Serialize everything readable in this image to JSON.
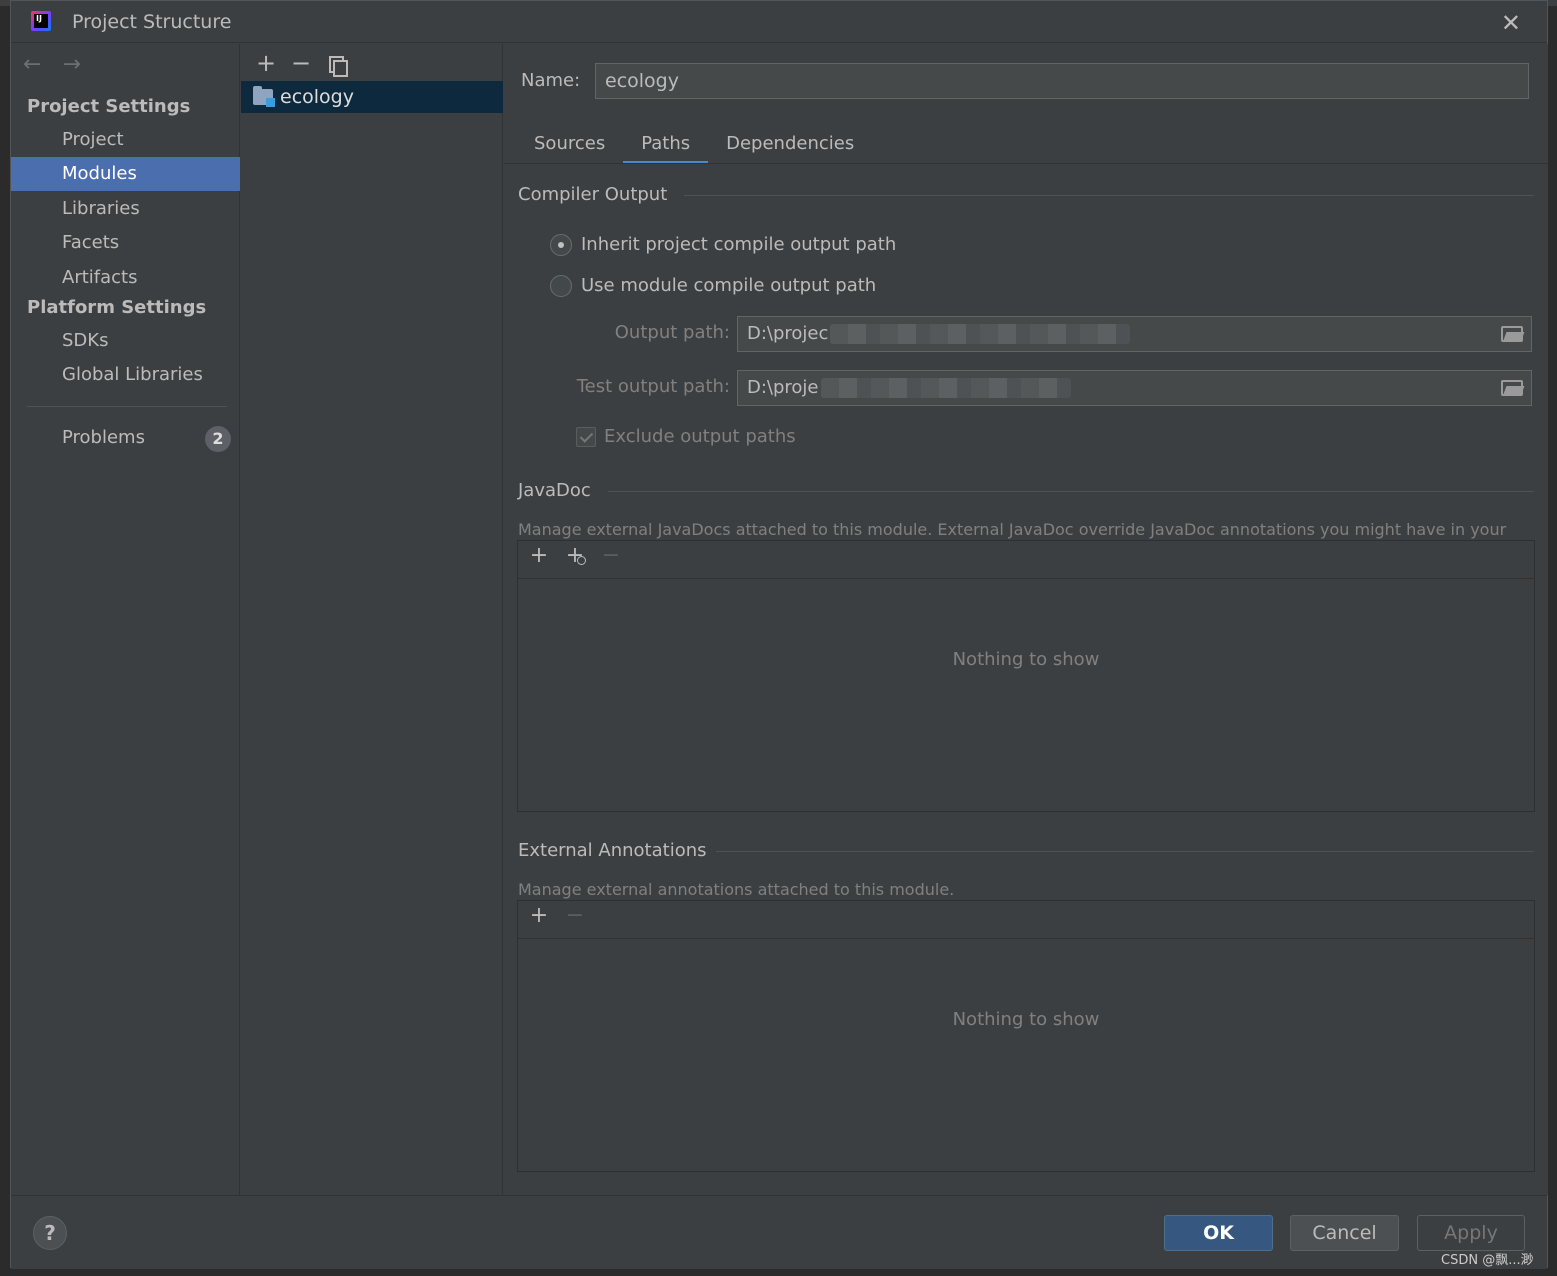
{
  "window": {
    "title": "Project Structure",
    "close_label": "✕"
  },
  "nav": {
    "back": "←",
    "forward": "→",
    "project_settings": "Project Settings",
    "project_items": [
      "Project",
      "Modules",
      "Libraries",
      "Facets",
      "Artifacts"
    ],
    "platform_settings": "Platform Settings",
    "platform_items": [
      "SDKs",
      "Global Libraries"
    ],
    "problems": "Problems",
    "problems_count": "2",
    "selected": "Modules"
  },
  "modules": {
    "toolbar": {
      "add": "+",
      "remove": "−"
    },
    "items": [
      "ecology"
    ]
  },
  "module": {
    "name_label": "Name:",
    "name_value": "ecology",
    "tabs": [
      "Sources",
      "Paths",
      "Dependencies"
    ],
    "active_tab": "Paths"
  },
  "compiler_output": {
    "title": "Compiler Output",
    "inherit_label": "Inherit project compile output path",
    "use_module_label": "Use module compile output path",
    "selected": "inherit",
    "output_path_label": "Output path:",
    "output_path_value": "D:\\projec",
    "test_output_path_label": "Test output path:",
    "test_output_path_value": "D:\\proje",
    "exclude_label": "Exclude output paths",
    "exclude_checked": true
  },
  "javadoc": {
    "title": "JavaDoc",
    "description": "Manage external JavaDocs attached to this module. External JavaDoc override JavaDoc annotations you might have in your module.",
    "add": "+",
    "add_url": "+",
    "remove": "−",
    "empty": "Nothing to show"
  },
  "annotations": {
    "title": "External Annotations",
    "description": "Manage external annotations attached to this module.",
    "add": "+",
    "remove": "−",
    "empty": "Nothing to show"
  },
  "footer": {
    "help": "?",
    "ok": "OK",
    "cancel": "Cancel",
    "apply": "Apply"
  },
  "watermark": "CSDN @飘...渺",
  "colors": {
    "accent": "#4b6eaf",
    "ok_button": "#365880",
    "selected_row": "#0d293e",
    "background": "#3c3f41"
  }
}
